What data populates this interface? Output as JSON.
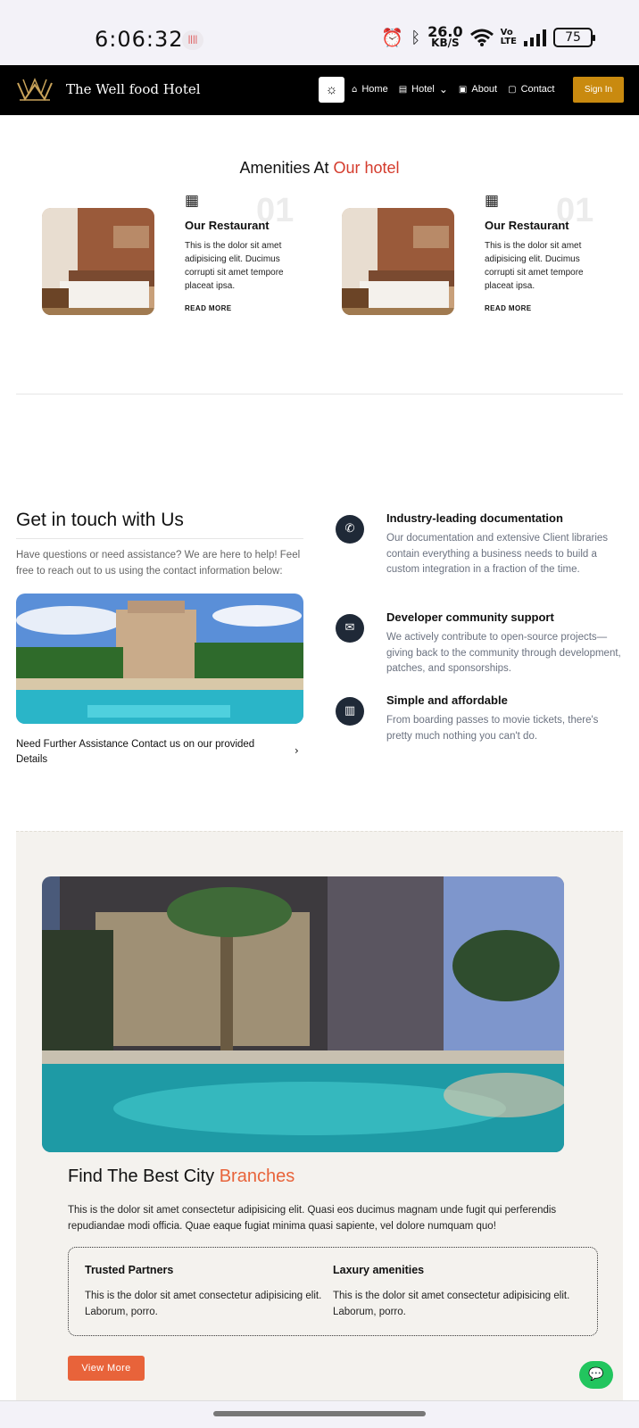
{
  "status_bar": {
    "time": "6:06:32",
    "net_speed_value": "26.0",
    "net_speed_unit": "KB/S",
    "volte_top": "Vo",
    "volte_bottom": "LTE",
    "battery": "75",
    "icons": [
      "alarm-icon",
      "bluetooth-icon",
      "wifi-icon",
      "signal-icon",
      "battery-icon"
    ]
  },
  "navbar": {
    "brand": "The Well food Hotel",
    "items": [
      {
        "label": "Home",
        "icon": "home-icon"
      },
      {
        "label": "Hotel",
        "icon": "building-icon"
      },
      {
        "label": "About",
        "icon": "info-icon"
      },
      {
        "label": "Contact",
        "icon": "contact-icon"
      }
    ],
    "signin_label": "Sign In"
  },
  "amenities": {
    "title_prefix": "Amenities At ",
    "title_accent": "Our hotel",
    "cards": [
      {
        "number": "01",
        "heading": "Our Restaurant",
        "text": "This is the dolor sit amet adipisicing elit. Ducimus corrupti sit amet tempore placeat ipsa.",
        "link": "READ MORE"
      },
      {
        "number": "01",
        "heading": "Our Restaurant",
        "text": "This is the dolor sit amet adipisicing elit. Ducimus corrupti sit amet tempore placeat ipsa.",
        "link": "READ MORE"
      }
    ]
  },
  "contact": {
    "title": "Get in touch with Us",
    "description": "Have questions or need assistance? We are here to help! Feel free to reach out to us using the contact information below:",
    "assist_text": "Need Further Assistance Contact us on our provided Details",
    "features": [
      {
        "icon": "phone-icon",
        "title": "Industry-leading documentation",
        "text": "Our documentation and extensive Client libraries contain everything a business needs to build a custom integration in a fraction of the time."
      },
      {
        "icon": "mail-icon",
        "title": "Developer community support",
        "text": "We actively contribute to open-source projects—giving back to the community through development, patches, and sponsorships."
      },
      {
        "icon": "map-icon",
        "title": "Simple and affordable",
        "text": "From boarding passes to movie tickets, there's pretty much nothing you can't do."
      }
    ]
  },
  "branches": {
    "title_prefix": "Find The Best City ",
    "title_accent": "Branches",
    "description": "This is the dolor sit amet consectetur adipisicing elit. Quasi eos ducimus magnam unde fugit qui perferendis repudiandae modi officia. Quae eaque fugiat minima quasi sapiente, vel dolore numquam quo!",
    "columns": [
      {
        "title": "Trusted Partners",
        "text": "This is the dolor sit amet consectetur adipisicing elit. Laborum, porro."
      },
      {
        "title": "Laxury amenities",
        "text": "This is the dolor sit amet consectetur adipisicing elit. Laborum, porro."
      }
    ],
    "button_label": "View More"
  },
  "colors": {
    "navbar_bg": "#000000",
    "signin_bg": "#c98a0f",
    "accent_red": "#d43b2c",
    "accent_orange": "#e8633a",
    "chat_green": "#22c55e"
  }
}
